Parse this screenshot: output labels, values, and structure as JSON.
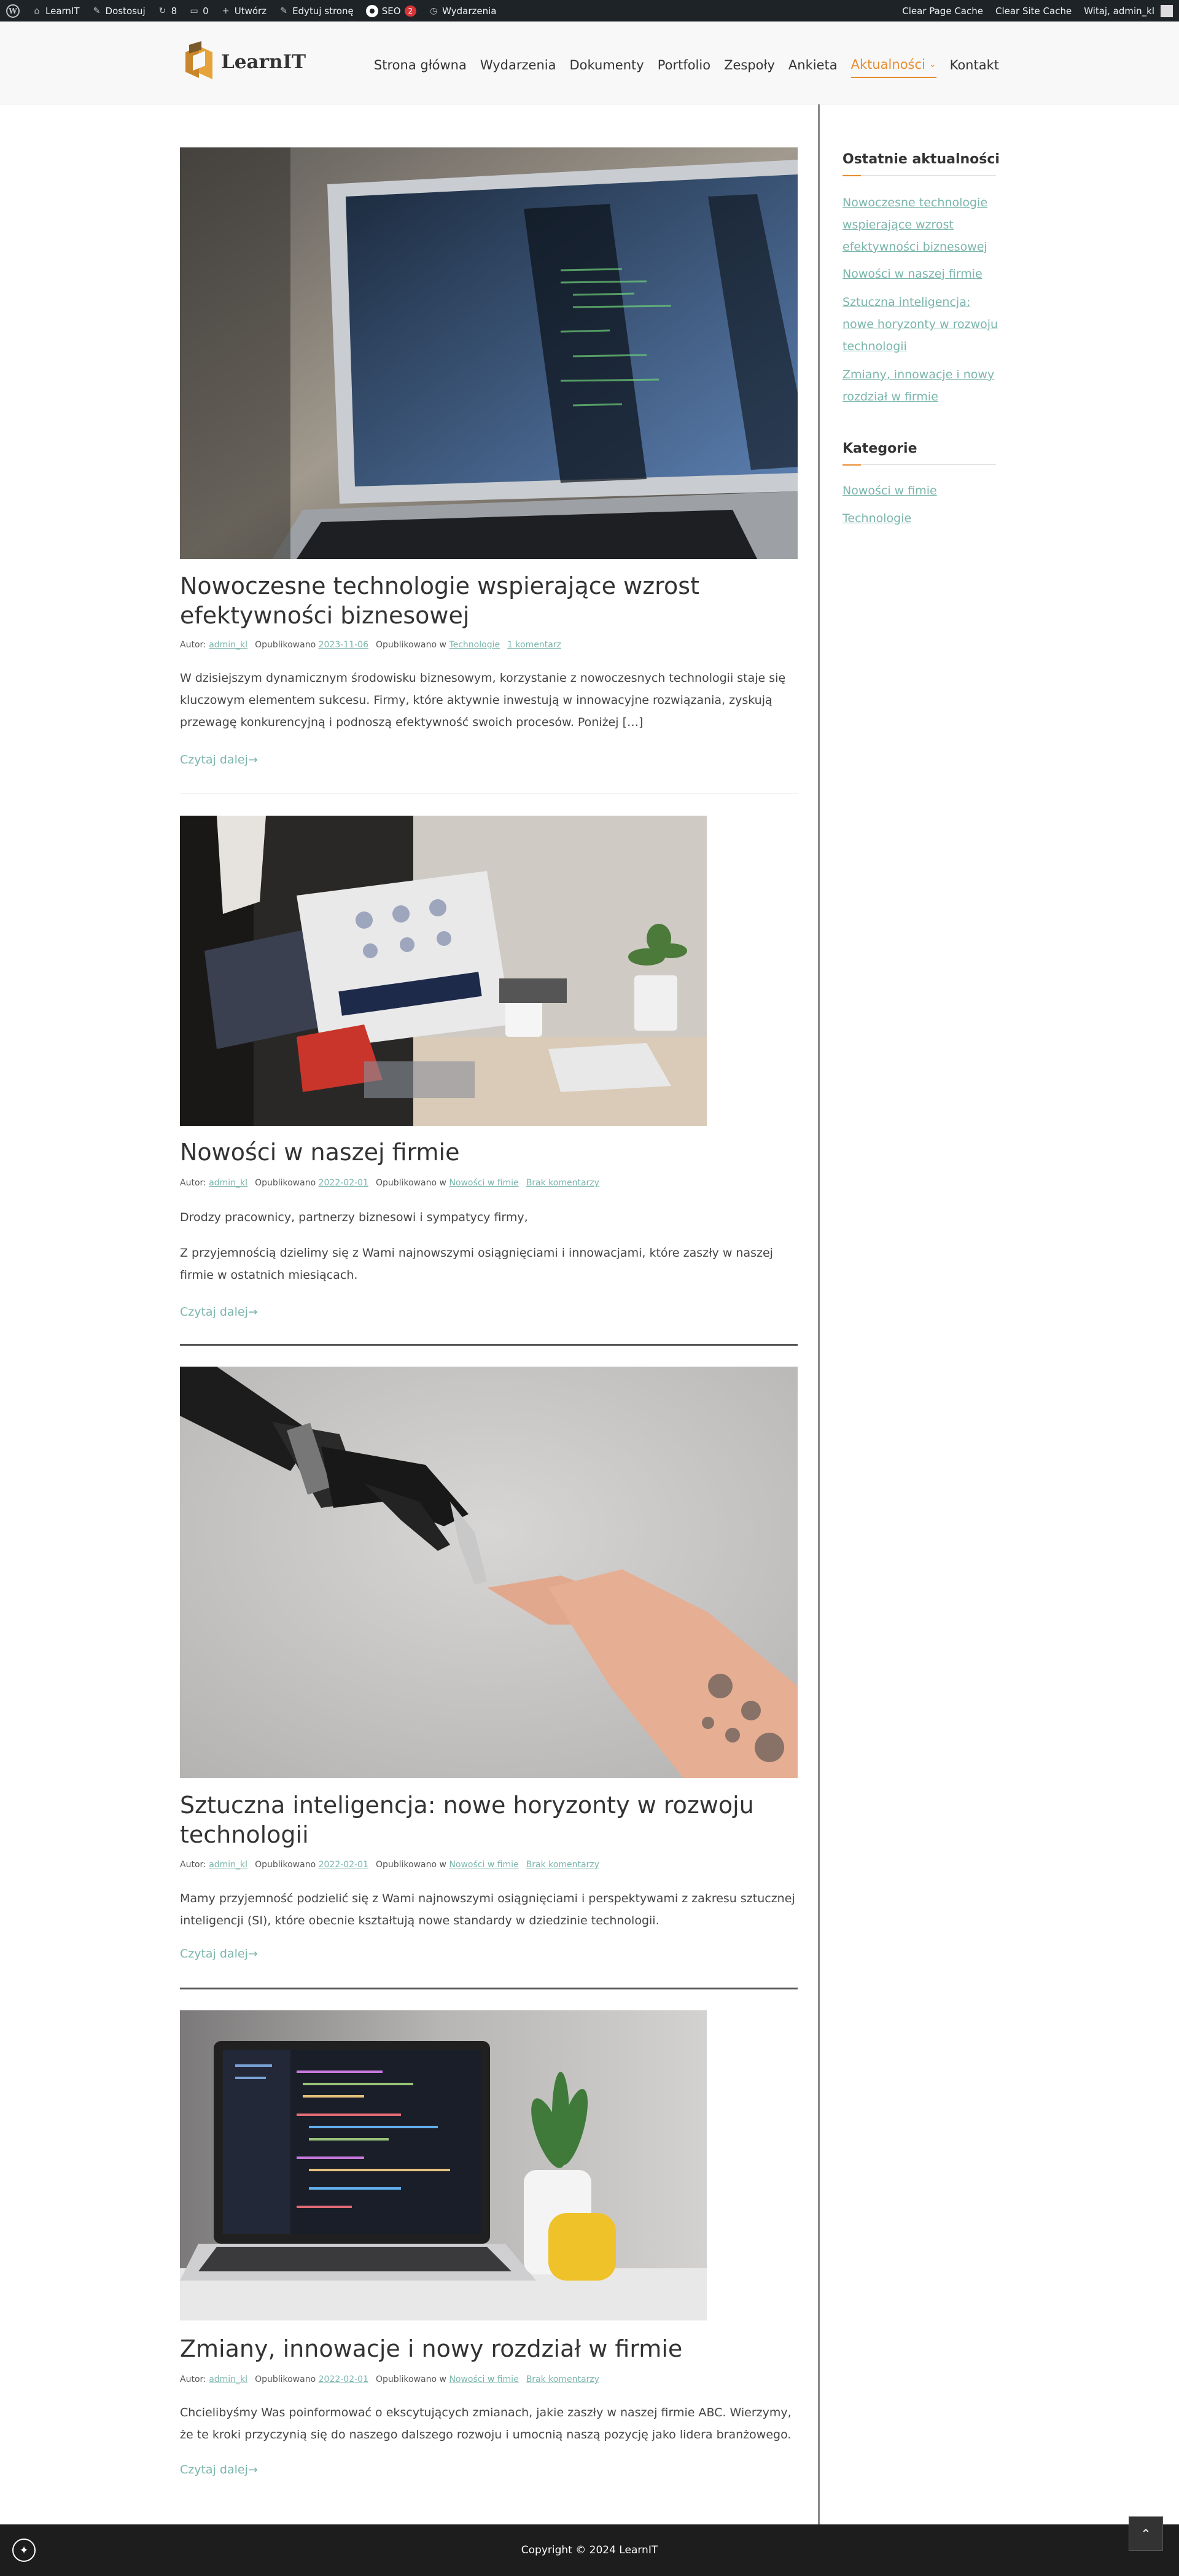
{
  "adminbar": {
    "site": "LearnIT",
    "customize": "Dostosuj",
    "updates_count": "8",
    "comments_count": "0",
    "new": "Utwórz",
    "edit_page": "Edytuj stronę",
    "seo": "SEO",
    "seo_badge": "2",
    "events": "Wydarzenia",
    "clear_page_cache": "Clear Page Cache",
    "clear_site_cache": "Clear Site Cache",
    "greeting": "Witaj, admin_kl"
  },
  "header": {
    "logo_text": "LearnIT",
    "nav": [
      {
        "label": "Strona główna"
      },
      {
        "label": "Wydarzenia"
      },
      {
        "label": "Dokumenty"
      },
      {
        "label": "Portfolio"
      },
      {
        "label": "Zespoły"
      },
      {
        "label": "Ankieta"
      },
      {
        "label": "Aktualności",
        "active": true
      },
      {
        "label": "Kontakt"
      }
    ]
  },
  "posts": [
    {
      "title": "Nowoczesne technologie wspierające wzrost efektywności biznesowej",
      "author_label": "Autor:",
      "author": "admin_kl",
      "published_label": "Opublikowano",
      "date": "2023-11-06",
      "category_label": "Opublikowano w",
      "category": "Technologie",
      "comments": "1 komentarz",
      "paragraphs": [
        "W dzisiejszym dynamicznym środowisku biznesowym, korzystanie z nowoczesnych technologii staje się kluczowym elementem sukcesu. Firmy, które aktywnie inwestują w innowacyjne rozwiązania, zyskują przewagę konkurencyjną i podnoszą efektywność swoich procesów. Poniżej […]"
      ],
      "read_more": "Czytaj dalej→"
    },
    {
      "title": "Nowości w naszej firmie",
      "author_label": "Autor:",
      "author": "admin_kl",
      "published_label": "Opublikowano",
      "date": "2022-02-01",
      "category_label": "Opublikowano w",
      "category": "Nowości w fimie",
      "comments": "Brak komentarzy",
      "paragraphs": [
        "Drodzy pracownicy, partnerzy biznesowi i sympatycy firmy,",
        "Z przyjemnością dzielimy się z Wami najnowszymi osiągnięciami i innowacjami, które zaszły w naszej firmie w ostatnich miesiącach."
      ],
      "read_more": "Czytaj dalej→"
    },
    {
      "title": "Sztuczna inteligencja: nowe horyzonty w rozwoju technologii",
      "author_label": "Autor:",
      "author": "admin_kl",
      "published_label": "Opublikowano",
      "date": "2022-02-01",
      "category_label": "Opublikowano w",
      "category": "Nowości w fimie",
      "comments": "Brak komentarzy",
      "paragraphs": [
        "Mamy przyjemność podzielić się z Wami najnowszymi osiągnięciami i perspektywami z zakresu sztucznej inteligencji (SI), które obecnie kształtują nowe standardy w dziedzinie technologii."
      ],
      "read_more": "Czytaj dalej→"
    },
    {
      "title": "Zmiany, innowacje i nowy rozdział w firmie",
      "author_label": "Autor:",
      "author": "admin_kl",
      "published_label": "Opublikowano",
      "date": "2022-02-01",
      "category_label": "Opublikowano w",
      "category": "Nowości w fimie",
      "comments": "Brak komentarzy",
      "paragraphs": [
        "Chcielibyśmy Was poinformować o ekscytujących zmianach, jakie zaszły w naszej firmie ABC. Wierzymy, że te kroki przyczynią się do naszego dalszego rozwoju i umocnią naszą pozycję jako lidera branżowego."
      ],
      "read_more": "Czytaj dalej→"
    }
  ],
  "sidebar": {
    "recent_title": "Ostatnie aktualności",
    "recent": [
      "Nowoczesne technologie wspierające wzrost efektywności biznesowej",
      "Nowości w naszej firmie",
      "Sztuczna inteligencja: nowe horyzonty w rozwoju technologii",
      "Zmiany, innowacje i nowy rozdział w firmie"
    ],
    "categories_title": "Kategorie",
    "categories": [
      "Nowości w fimie",
      "Technologie"
    ]
  },
  "footer": {
    "copyright": "Copyright © 2024 LearnIT"
  },
  "colors": {
    "accent": "#e88b2e",
    "link": "#7ab5ab",
    "adminbar": "#1d2327",
    "footer": "#1d1d1d"
  }
}
